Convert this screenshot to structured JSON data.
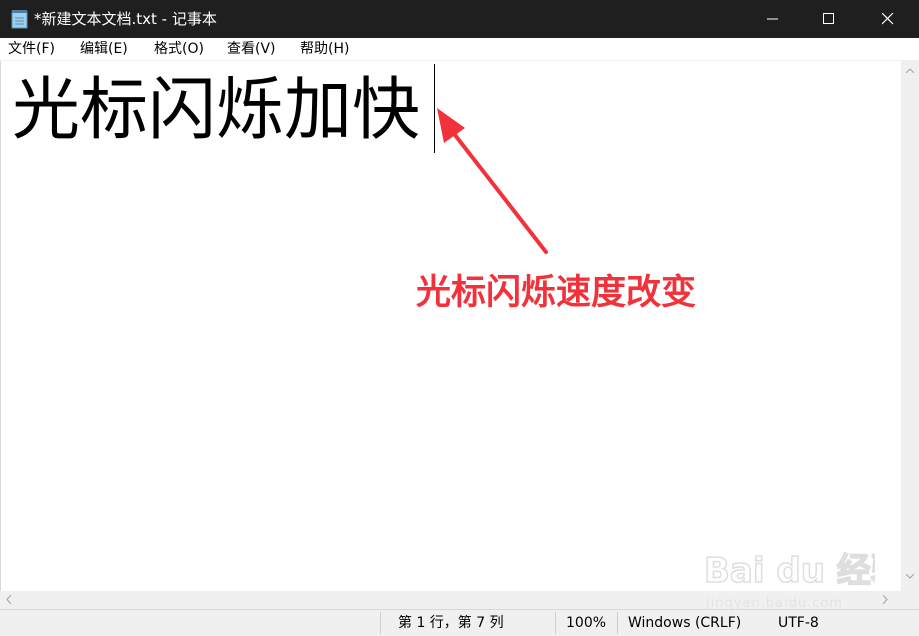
{
  "window": {
    "title": "*新建文本文档.txt - 记事本"
  },
  "menu": {
    "items": [
      "文件(F)",
      "编辑(E)",
      "格式(O)",
      "查看(V)",
      "帮助(H)"
    ]
  },
  "editor": {
    "content": "光标闪烁加快"
  },
  "annotation": {
    "text": "光标闪烁速度改变",
    "color": "#f2323b"
  },
  "status": {
    "position": "第 1 行，第 7 列",
    "zoom": "100%",
    "line_ending": "Windows (CRLF)",
    "encoding": "UTF-8"
  },
  "watermark": {
    "logo_text": "Bai du 经验",
    "url": "jingyan.baidu.com"
  },
  "colors": {
    "titlebar": "#1f1f1f",
    "status_bg": "#f0f0f0"
  }
}
